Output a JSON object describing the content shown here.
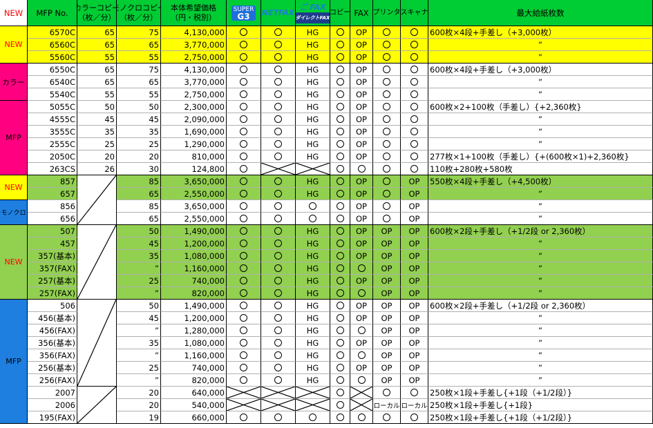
{
  "headers": {
    "new": "NEW",
    "mfp_no": "MFP No.",
    "color_copy": [
      "カラーコピー",
      "（枚／分）"
    ],
    "mono_copy": [
      "モノクロコピー",
      "（枚／分）"
    ],
    "price": [
      "本体希望価格",
      "（円・税別）"
    ],
    "supergb_logo": [
      "SUPER",
      "G3"
    ],
    "netfax_logo": "NETFAX",
    "dfax_logo": [
      "ご FAX",
      "ダイレクトFAX"
    ],
    "copy": "コピー",
    "fax": "FAX",
    "printer": "プリンタ",
    "scanner": "スキャナ",
    "max_paper": "最大給紙枚数"
  },
  "groups": [
    {
      "label": "NEW",
      "color": "#ffff00",
      "start": 0,
      "count": 3,
      "label_color": "#ff0000"
    },
    {
      "label": "カラー",
      "color": "#ff0080",
      "start": 3,
      "count": 3,
      "label_color": "#000000"
    },
    {
      "label": "MFP",
      "color": "#ff0080",
      "start": 6,
      "count": 6,
      "label_color": "#000000"
    },
    {
      "label": "NEW",
      "color": "#ffff00",
      "start": 12,
      "count": 2,
      "label_color": "#ff0000"
    },
    {
      "label": "モノクロ",
      "color": "#1e7fe0",
      "start": 14,
      "count": 2,
      "label_color": "#000000"
    },
    {
      "label": "NEW",
      "color": "#92d050",
      "start": 16,
      "count": 6,
      "label_color": "#ff0000"
    },
    {
      "label": "MFP",
      "color": "#1e7fe0",
      "start": 22,
      "count": 10,
      "label_color": "#000000"
    }
  ],
  "rows": [
    {
      "no": "6570C",
      "color": "65",
      "mono": "75",
      "price": "4,130,000",
      "sg": "o",
      "nf": "o",
      "df": "HG",
      "copy": "o",
      "fax": "OP",
      "prn": "o",
      "scn": "o",
      "paper": "600枚×4段+手差し（+3,000枚）",
      "bg": "#ffff00"
    },
    {
      "no": "6560C",
      "color": "65",
      "mono": "65",
      "price": "3,770,000",
      "sg": "o",
      "nf": "o",
      "df": "HG",
      "copy": "o",
      "fax": "OP",
      "prn": "o",
      "scn": "o",
      "paper": "”",
      "bg": "#ffff00"
    },
    {
      "no": "5560C",
      "color": "55",
      "mono": "55",
      "price": "2,750,000",
      "sg": "o",
      "nf": "o",
      "df": "HG",
      "copy": "o",
      "fax": "OP",
      "prn": "o",
      "scn": "o",
      "paper": "”",
      "bg": "#ffff00"
    },
    {
      "no": "6550C",
      "color": "65",
      "mono": "75",
      "price": "4,130,000",
      "sg": "o",
      "nf": "o",
      "df": "HG",
      "copy": "o",
      "fax": "OP",
      "prn": "o",
      "scn": "o",
      "paper": "600枚×4段+手差し（+3,000枚）",
      "bg": "#ffffff"
    },
    {
      "no": "6540C",
      "color": "65",
      "mono": "65",
      "price": "3,770,000",
      "sg": "o",
      "nf": "o",
      "df": "HG",
      "copy": "o",
      "fax": "OP",
      "prn": "o",
      "scn": "o",
      "paper": "”",
      "bg": "#ffffff"
    },
    {
      "no": "5540C",
      "color": "55",
      "mono": "55",
      "price": "2,750,000",
      "sg": "o",
      "nf": "o",
      "df": "HG",
      "copy": "o",
      "fax": "OP",
      "prn": "o",
      "scn": "o",
      "paper": "”",
      "bg": "#ffffff"
    },
    {
      "no": "5055C",
      "color": "50",
      "mono": "50",
      "price": "2,300,000",
      "sg": "o",
      "nf": "o",
      "df": "HG",
      "copy": "o",
      "fax": "OP",
      "prn": "o",
      "scn": "o",
      "paper": "600枚×2+100枚（手差し）{+2,360枚}",
      "bg": "#ffffff"
    },
    {
      "no": "4555C",
      "color": "45",
      "mono": "45",
      "price": "2,090,000",
      "sg": "o",
      "nf": "o",
      "df": "HG",
      "copy": "o",
      "fax": "OP",
      "prn": "o",
      "scn": "o",
      "paper": "”",
      "bg": "#ffffff"
    },
    {
      "no": "3555C",
      "color": "35",
      "mono": "35",
      "price": "1,690,000",
      "sg": "o",
      "nf": "o",
      "df": "HG",
      "copy": "o",
      "fax": "OP",
      "prn": "o",
      "scn": "o",
      "paper": "”",
      "bg": "#ffffff"
    },
    {
      "no": "2555C",
      "color": "25",
      "mono": "25",
      "price": "1,290,000",
      "sg": "o",
      "nf": "o",
      "df": "HG",
      "copy": "o",
      "fax": "OP",
      "prn": "o",
      "scn": "o",
      "paper": "”",
      "bg": "#ffffff"
    },
    {
      "no": "2050C",
      "color": "20",
      "mono": "20",
      "price": "810,000",
      "sg": "o",
      "nf": "o",
      "df": "HG",
      "copy": "o",
      "fax": "OP",
      "prn": "o",
      "scn": "o",
      "paper": "277枚×1+100枚（手差し）{+(600枚×1)+2,360枚}",
      "bg": "#ffffff"
    },
    {
      "no": "263CS",
      "color": "26",
      "mono": "30",
      "price": "124,800",
      "sg": "o",
      "nf": "x",
      "df": "x",
      "copy": "o",
      "fax": "o",
      "prn": "o",
      "scn": "o",
      "paper": "110枚+280枚+580枚",
      "bg": "#ffffff"
    },
    {
      "no": "857",
      "color": "",
      "mono": "85",
      "price": "3,650,000",
      "sg": "o",
      "nf": "o",
      "df": "HG",
      "copy": "o",
      "fax": "OP",
      "prn": "o",
      "scn": "OP",
      "paper": "550枚×4段+手差し（+4,500枚）",
      "bg": "#92d050"
    },
    {
      "no": "657",
      "color": "",
      "mono": "65",
      "price": "2,550,000",
      "sg": "o",
      "nf": "o",
      "df": "HG",
      "copy": "o",
      "fax": "OP",
      "prn": "o",
      "scn": "OP",
      "paper": "”",
      "bg": "#92d050"
    },
    {
      "no": "856",
      "color": "",
      "mono": "85",
      "price": "3,650,000",
      "sg": "o",
      "nf": "o",
      "df": "o",
      "copy": "o",
      "fax": "OP",
      "prn": "o",
      "scn": "OP",
      "paper": "”",
      "bg": "#ffffff"
    },
    {
      "no": "656",
      "color": "",
      "mono": "65",
      "price": "2,550,000",
      "sg": "o",
      "nf": "o",
      "df": "o",
      "copy": "o",
      "fax": "OP",
      "prn": "o",
      "scn": "OP",
      "paper": "”",
      "bg": "#ffffff"
    },
    {
      "no": "507",
      "color": "",
      "mono": "50",
      "price": "1,490,000",
      "sg": "o",
      "nf": "o",
      "df": "HG",
      "copy": "o",
      "fax": "OP",
      "prn": "OP",
      "scn": "OP",
      "paper": "600枚×2段+手差し（+1/2段 or 2,360枚）",
      "bg": "#92d050"
    },
    {
      "no": "457",
      "color": "",
      "mono": "45",
      "price": "1,200,000",
      "sg": "o",
      "nf": "o",
      "df": "HG",
      "copy": "o",
      "fax": "OP",
      "prn": "OP",
      "scn": "OP",
      "paper": "”",
      "bg": "#92d050"
    },
    {
      "no": "357(基本)",
      "color": "",
      "mono": "35",
      "price": "1,080,000",
      "sg": "o",
      "nf": "o",
      "df": "HG",
      "copy": "o",
      "fax": "OP",
      "prn": "OP",
      "scn": "OP",
      "paper": "”",
      "bg": "#92d050"
    },
    {
      "no": "357(FAX)",
      "color": "",
      "mono": "”",
      "price": "1,160,000",
      "sg": "o",
      "nf": "o",
      "df": "HG",
      "copy": "o",
      "fax": "o",
      "prn": "OP",
      "scn": "OP",
      "paper": "”",
      "bg": "#92d050"
    },
    {
      "no": "257(基本)",
      "color": "",
      "mono": "25",
      "price": "740,000",
      "sg": "o",
      "nf": "o",
      "df": "HG",
      "copy": "o",
      "fax": "OP",
      "prn": "OP",
      "scn": "OP",
      "paper": "”",
      "bg": "#92d050"
    },
    {
      "no": "257(FAX)",
      "color": "",
      "mono": "”",
      "price": "820,000",
      "sg": "o",
      "nf": "o",
      "df": "HG",
      "copy": "o",
      "fax": "o",
      "prn": "OP",
      "scn": "OP",
      "paper": "”",
      "bg": "#92d050"
    },
    {
      "no": "506",
      "color": "",
      "mono": "50",
      "price": "1,490,000",
      "sg": "o",
      "nf": "o",
      "df": "HG",
      "copy": "o",
      "fax": "OP",
      "prn": "OP",
      "scn": "OP",
      "paper": "600枚×2段+手差し（+1/2段 or 2,360枚）",
      "bg": "#ffffff"
    },
    {
      "no": "456(基本)",
      "color": "",
      "mono": "45",
      "price": "1,200,000",
      "sg": "o",
      "nf": "o",
      "df": "HG",
      "copy": "o",
      "fax": "OP",
      "prn": "OP",
      "scn": "OP",
      "paper": "”",
      "bg": "#ffffff"
    },
    {
      "no": "456(FAX)",
      "color": "",
      "mono": "”",
      "price": "1,280,000",
      "sg": "o",
      "nf": "o",
      "df": "HG",
      "copy": "o",
      "fax": "o",
      "prn": "OP",
      "scn": "OP",
      "paper": "”",
      "bg": "#ffffff"
    },
    {
      "no": "356(基本)",
      "color": "",
      "mono": "35",
      "price": "1,080,000",
      "sg": "o",
      "nf": "o",
      "df": "HG",
      "copy": "o",
      "fax": "OP",
      "prn": "OP",
      "scn": "OP",
      "paper": "”",
      "bg": "#ffffff"
    },
    {
      "no": "356(FAX)",
      "color": "",
      "mono": "”",
      "price": "1,160,000",
      "sg": "o",
      "nf": "o",
      "df": "HG",
      "copy": "o",
      "fax": "o",
      "prn": "OP",
      "scn": "OP",
      "paper": "”",
      "bg": "#ffffff"
    },
    {
      "no": "256(基本)",
      "color": "",
      "mono": "25",
      "price": "740,000",
      "sg": "o",
      "nf": "o",
      "df": "HG",
      "copy": "o",
      "fax": "OP",
      "prn": "OP",
      "scn": "OP",
      "paper": "”",
      "bg": "#ffffff"
    },
    {
      "no": "256(FAX)",
      "color": "",
      "mono": "”",
      "price": "820,000",
      "sg": "o",
      "nf": "o",
      "df": "HG",
      "copy": "o",
      "fax": "o",
      "prn": "OP",
      "scn": "OP",
      "paper": "”",
      "bg": "#ffffff"
    },
    {
      "no": "2007",
      "color": "",
      "mono": "20",
      "price": "640,000",
      "sg": "x",
      "nf": "x",
      "df": "x",
      "copy": "o",
      "fax": "x",
      "prn": "o",
      "scn": "o",
      "paper": "250枚×1段+手差し{+1段（+1/2段）}",
      "bg": "#ffffff"
    },
    {
      "no": "2006",
      "color": "",
      "mono": "20",
      "price": "540,000",
      "sg": "x",
      "nf": "x",
      "df": "x",
      "copy": "o",
      "fax": "x",
      "prn": "ローカル",
      "scn": "ローカル",
      "paper": "250枚×1段+手差し{+1段}",
      "bg": "#ffffff"
    },
    {
      "no": "195(FAX)",
      "color": "",
      "mono": "19",
      "price": "660,000",
      "sg": "o",
      "nf": "o",
      "df": "o",
      "copy": "o",
      "fax": "o",
      "prn": "o",
      "scn": "o",
      "paper": "250枚×1段+手差し{+1段（+1/2段）}",
      "bg": "#ffffff"
    }
  ],
  "colors": {
    "header_green": "#00cc33",
    "yellow": "#ffff00",
    "magenta": "#ff0080",
    "light_green": "#92d050",
    "blue": "#1e7fe0",
    "new_red": "#ff0000"
  }
}
